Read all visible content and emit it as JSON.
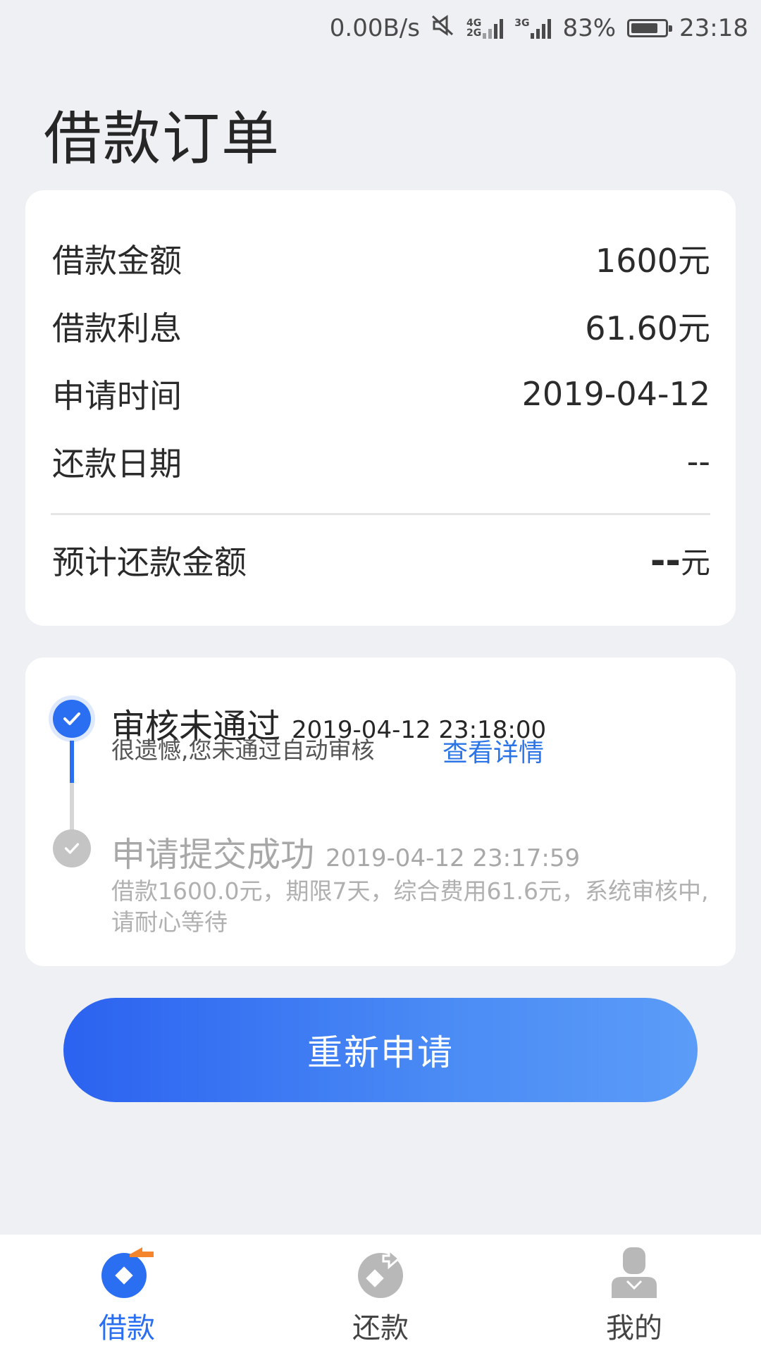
{
  "status_bar": {
    "net_speed": "0.00B/s",
    "net_type_a_top": "4G",
    "net_type_a_bottom": "2G",
    "net_type_b": "3G",
    "battery": "83%",
    "battery_level_percent": 83,
    "time": "23:18"
  },
  "page_title": "借款订单",
  "summary": {
    "rows": [
      {
        "label": "借款金额",
        "value": "1600元"
      },
      {
        "label": "借款利息",
        "value": "61.60元"
      },
      {
        "label": "申请时间",
        "value": "2019-04-12"
      },
      {
        "label": "还款日期",
        "value": "--"
      }
    ],
    "total_label": "预计还款金额",
    "total_value": "--",
    "total_unit": "元"
  },
  "timeline": [
    {
      "title": "审核未通过",
      "time": "2019-04-12 23:18:00",
      "desc": "很遗憾,您未通过自动审核",
      "link": "查看详情"
    },
    {
      "title": "申请提交成功",
      "time": "2019-04-12 23:17:59",
      "desc": "借款1600.0元，期限7天，综合费用61.6元，系统审核中,请耐心等待"
    }
  ],
  "reapply_button": "重新申请",
  "tabs": [
    {
      "label": "借款",
      "icon": "loan-icon",
      "active": true
    },
    {
      "label": "还款",
      "icon": "repay-icon",
      "active": false
    },
    {
      "label": "我的",
      "icon": "user-icon",
      "active": false
    }
  ],
  "colors": {
    "accent": "#2a6ef2",
    "background": "#eef0f4"
  }
}
